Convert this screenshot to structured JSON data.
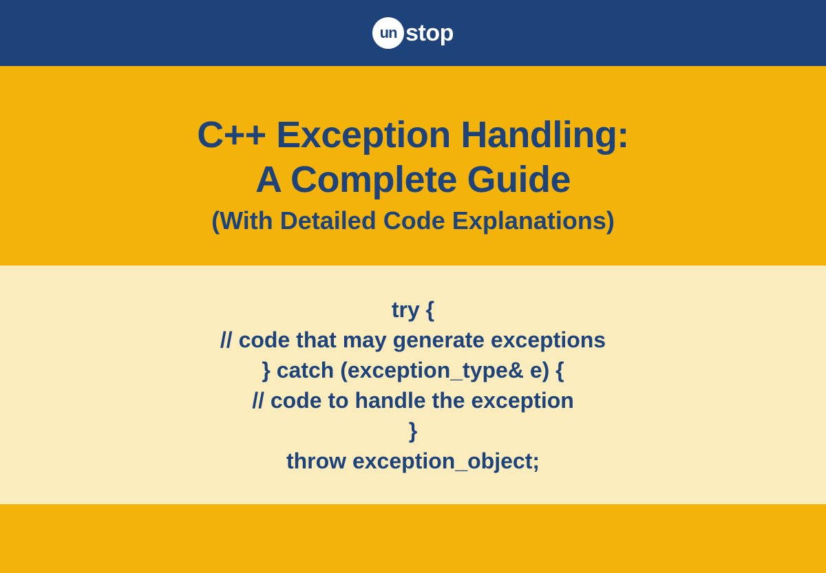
{
  "logo": {
    "circle_text": "un",
    "rest_text": "stop"
  },
  "title": {
    "line1": "C++ Exception Handling:",
    "line2": "A Complete Guide",
    "subtitle": "(With Detailed Code Explanations)"
  },
  "code": {
    "line1": "try {",
    "line2": "// code that may generate exceptions",
    "line3": "} catch (exception_type& e) {",
    "line4": "// code to handle the exception",
    "line5": "}",
    "line6": "throw exception_object;"
  },
  "colors": {
    "header": "#1d437a",
    "accent": "#f4b30a",
    "light": "#fbecbe",
    "text": "#1d437a"
  }
}
